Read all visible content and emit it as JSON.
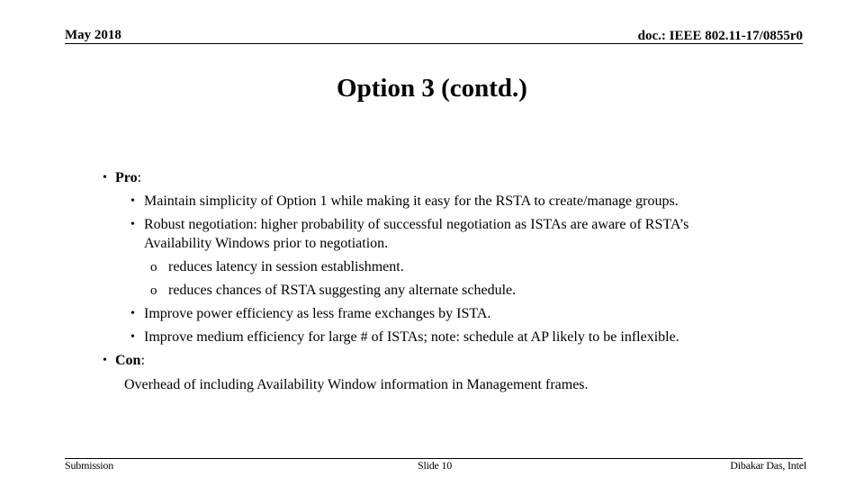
{
  "header": {
    "date": "May 2018",
    "doc_id": "doc.: IEEE 802.11-17/0855r0"
  },
  "title": "Option 3 (contd.)",
  "content": {
    "pro_label": "Pro",
    "pro_colon": ":",
    "pro_items": [
      "Maintain simplicity of Option 1 while making it easy for the RSTA to create/manage groups.",
      "Robust negotiation: higher probability of successful negotiation as ISTAs are aware of RSTA’s",
      "Availability Windows prior to negotiation.",
      "reduces latency in session establishment.",
      "reduces chances of RSTA suggesting any alternate schedule.",
      "Improve power efficiency as less frame exchanges by ISTA.",
      " Improve medium efficiency for large # of ISTAs; note: schedule at AP likely to be inflexible."
    ],
    "con_label": "Con",
    "con_colon": ":",
    "con_text": "Overhead of including Availability Window information in Management frames.",
    "bullet_glyph": "•",
    "sub_bullet_glyph": "o"
  },
  "footer": {
    "left": "Submission",
    "center": "Slide 10",
    "right": "Dibakar Das, Intel"
  }
}
